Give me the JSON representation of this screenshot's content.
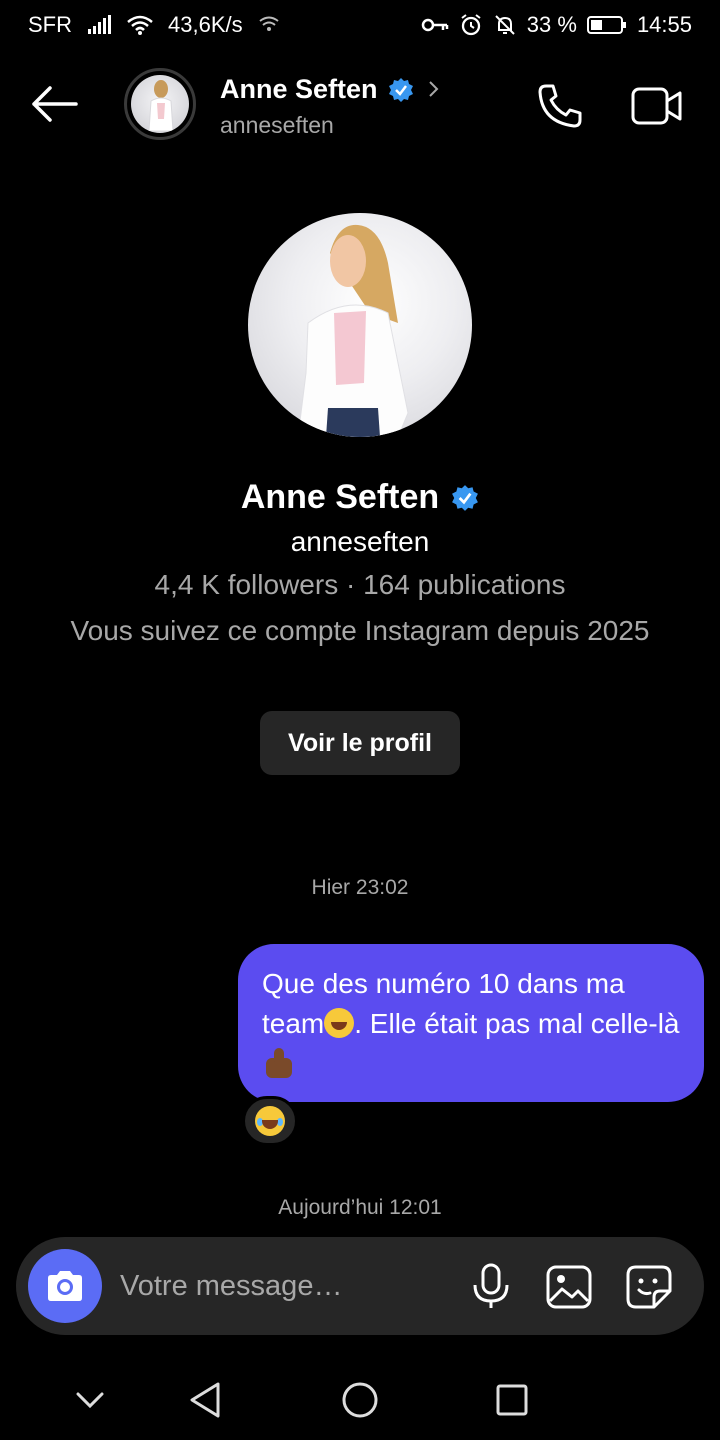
{
  "status_bar": {
    "carrier": "SFR",
    "network_speed": "43,6K/s",
    "battery_percent": "33 %",
    "time": "14:55",
    "icons": [
      "signal-icon",
      "wifi-icon",
      "hotspot-icon",
      "key-icon",
      "alarm-icon",
      "bell-off-icon",
      "battery-icon"
    ]
  },
  "header": {
    "name": "Anne Seften",
    "username": "anneseften",
    "verified": true,
    "icons": [
      "back-arrow-icon",
      "chevron-right-icon",
      "phone-icon",
      "video-icon"
    ]
  },
  "profile": {
    "name": "Anne Seften",
    "username": "anneseften",
    "stats": "4,4 K followers · 164 publications",
    "since": "Vous suivez ce compte Instagram depuis 2025",
    "view_button": "Voir le profil"
  },
  "messages": [
    {
      "timestamp": "Hier 23:02",
      "text_part1": "Que des numéro 10 dans ma team",
      "text_part2": ". Elle était pas mal celle-là ",
      "emojis": [
        "rolling-laughing-emoji",
        "thumbs-up-emoji"
      ],
      "reaction": "tears-of-joy-emoji"
    }
  ],
  "timestamp_today": "Aujourd’hui 12:01",
  "composer": {
    "placeholder": "Votre message…",
    "icons": [
      "camera-icon",
      "mic-icon",
      "gallery-icon",
      "sticker-icon"
    ]
  },
  "colors": {
    "background": "#000000",
    "bubble": "#5b4cf0",
    "camera_button": "#5b6cf5",
    "verified": "#3897f0",
    "muted_text": "#a8a8a8",
    "surface": "#262626"
  },
  "nav": {
    "icons": [
      "nav-collapse-icon",
      "nav-back-icon",
      "nav-home-icon",
      "nav-recents-icon"
    ]
  }
}
